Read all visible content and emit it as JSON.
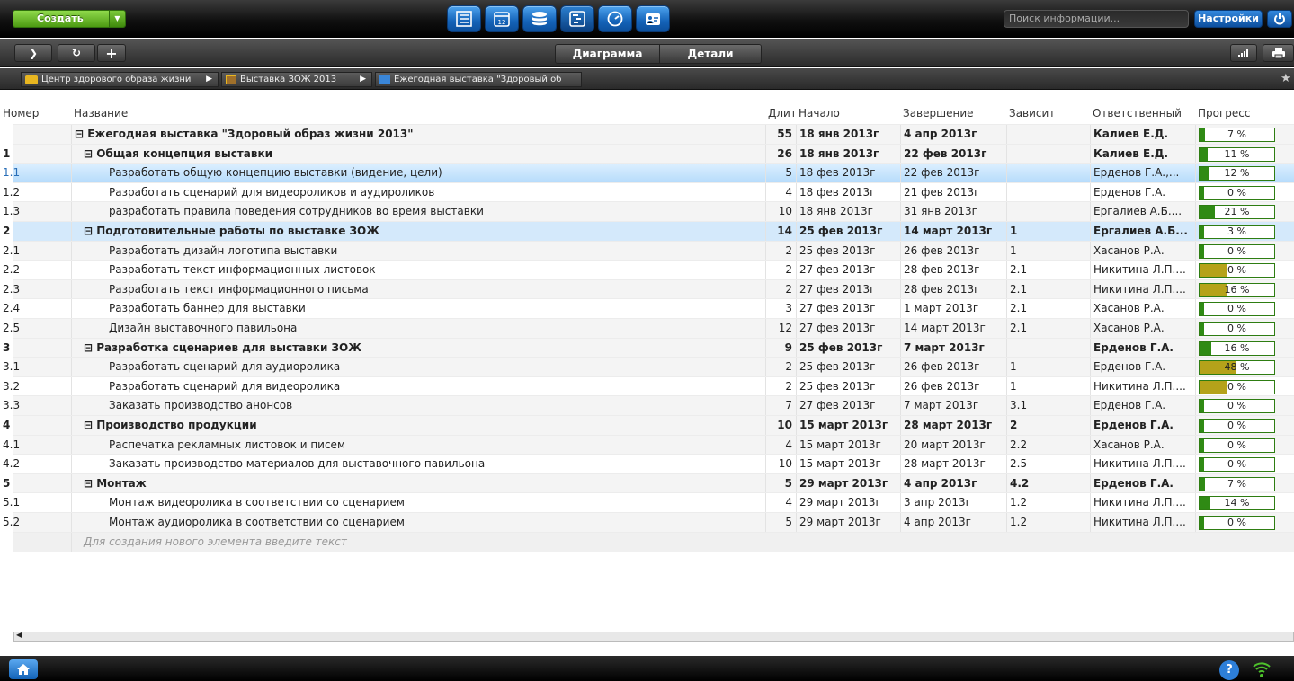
{
  "topbar": {
    "create_label": "Создать",
    "search_placeholder": "Поиск информации...",
    "settings_label": "Настройки",
    "views": [
      "tasks-icon",
      "calendar-icon",
      "database-icon",
      "gantt-icon",
      "dashboard-icon",
      "contacts-icon"
    ]
  },
  "toolbar": {
    "tab_diagram": "Диаграмма",
    "tab_details": "Детали"
  },
  "breadcrumbs": [
    {
      "label": "Центр здорового образа жизни",
      "icon": "folder-icon"
    },
    {
      "label": "Выставка ЗОЖ 2013",
      "icon": "project-icon"
    },
    {
      "label": "Ежегодная выставка \"Здоровый об",
      "icon": "gantt-icon"
    }
  ],
  "columns": {
    "num": "Номер",
    "name": "Название",
    "dur": "Длител",
    "start": "Начало",
    "end": "Завершение",
    "dep": "Зависит",
    "owner": "Ответственный",
    "progress": "Прогресс"
  },
  "rows": [
    {
      "num": "",
      "name": "⊟ Ежегодная выставка \"Здоровый образ жизни 2013\"",
      "dur": "55",
      "start": "18 янв 2013г",
      "end": "4 апр 2013г",
      "dep": "",
      "owner": "Калиев Е.Д.",
      "progress": "7 %",
      "pct": 7,
      "level": 0,
      "summary": true
    },
    {
      "num": "1",
      "name": "⊟ Общая концепция выставки",
      "dur": "26",
      "start": "18 янв 2013г",
      "end": "22 фев 2013г",
      "dep": "",
      "owner": "Калиев Е.Д.",
      "progress": "11 %",
      "pct": 11,
      "level": 1,
      "summary": true
    },
    {
      "num": "1.1",
      "name": "Разработать общую концепцию выставки (видение, цели)",
      "dur": "5",
      "start": "18 фев 2013г",
      "end": "22 фев 2013г",
      "dep": "",
      "owner": "Ерденов Г.А.,...",
      "progress": "12 %",
      "pct": 12,
      "level": 2,
      "selected": true
    },
    {
      "num": "1.2",
      "name": "Разработать сценарий для видеороликов и аудироликов",
      "dur": "4",
      "start": "18 фев 2013г",
      "end": "21 фев 2013г",
      "dep": "",
      "owner": "Ерденов Г.А.",
      "progress": "0 %",
      "pct": 0,
      "level": 2
    },
    {
      "num": "1.3",
      "name": "разработать правила поведения сотрудников во время выставки",
      "dur": "10",
      "start": "18 янв 2013г",
      "end": "31 янв 2013г",
      "dep": "",
      "owner": "Ергалиев А.Б....",
      "progress": "21 %",
      "pct": 21,
      "level": 2
    },
    {
      "num": "2",
      "name": "⊟ Подготовительные работы по выставке ЗОЖ",
      "dur": "14",
      "start": "25 фев 2013г",
      "end": "14 март 2013г",
      "dep": "1",
      "owner": "Ергалиев А.Б...",
      "progress": "3 %",
      "pct": 3,
      "level": 1,
      "summary": true,
      "hl": true
    },
    {
      "num": "2.1",
      "name": "Разработать дизайн логотипа выставки",
      "dur": "2",
      "start": "25 фев 2013г",
      "end": "26 фев 2013г",
      "dep": "1",
      "owner": "Хасанов Р.А.",
      "progress": "0 %",
      "pct": 0,
      "level": 2
    },
    {
      "num": "2.2",
      "name": "Разработать текст информационных листовок",
      "dur": "2",
      "start": "27 фев 2013г",
      "end": "28 фев 2013г",
      "dep": "2.1",
      "owner": "Никитина Л.П....",
      "progress": "0 %",
      "pct": 0,
      "level": 2,
      "warn": true
    },
    {
      "num": "2.3",
      "name": "Разработать текст информационного письма",
      "dur": "2",
      "start": "27 фев 2013г",
      "end": "28 фев 2013г",
      "dep": "2.1",
      "owner": "Никитина Л.П....",
      "progress": "16 %",
      "pct": 16,
      "level": 2,
      "warn": true
    },
    {
      "num": "2.4",
      "name": "Разработать баннер для выставки",
      "dur": "3",
      "start": "27 фев 2013г",
      "end": "1 март 2013г",
      "dep": "2.1",
      "owner": "Хасанов Р.А.",
      "progress": "0 %",
      "pct": 0,
      "level": 2
    },
    {
      "num": "2.5",
      "name": "Дизайн выставочного павильона",
      "dur": "12",
      "start": "27 фев 2013г",
      "end": "14 март 2013г",
      "dep": "2.1",
      "owner": "Хасанов Р.А.",
      "progress": "0 %",
      "pct": 0,
      "level": 2
    },
    {
      "num": "3",
      "name": "⊟ Разработка сценариев для выставки ЗОЖ",
      "dur": "9",
      "start": "25 фев 2013г",
      "end": "7 март 2013г",
      "dep": "",
      "owner": "Ерденов Г.А.",
      "progress": "16 %",
      "pct": 16,
      "level": 1,
      "summary": true
    },
    {
      "num": "3.1",
      "name": "Разработать сценарий для аудиоролика",
      "dur": "2",
      "start": "25 фев 2013г",
      "end": "26 фев 2013г",
      "dep": "1",
      "owner": "Ерденов Г.А.",
      "progress": "48 %",
      "pct": 48,
      "level": 2,
      "warn": true
    },
    {
      "num": "3.2",
      "name": "Разработать сценарий для видеоролика",
      "dur": "2",
      "start": "25 фев 2013г",
      "end": "26 фев 2013г",
      "dep": "1",
      "owner": "Никитина Л.П....",
      "progress": "0 %",
      "pct": 0,
      "level": 2,
      "warn": true
    },
    {
      "num": "3.3",
      "name": "Заказать производство анонсов",
      "dur": "7",
      "start": "27 фев 2013г",
      "end": "7 март 2013г",
      "dep": "3.1",
      "owner": "Ерденов Г.А.",
      "progress": "0 %",
      "pct": 0,
      "level": 2
    },
    {
      "num": "4",
      "name": "⊟ Производство продукции",
      "dur": "10",
      "start": "15 март 2013г",
      "end": "28 март 2013г",
      "dep": "2",
      "owner": "Ерденов Г.А.",
      "progress": "0 %",
      "pct": 0,
      "level": 1,
      "summary": true
    },
    {
      "num": "4.1",
      "name": "Распечатка рекламных листовок и писем",
      "dur": "4",
      "start": "15 март 2013г",
      "end": "20 март 2013г",
      "dep": "2.2",
      "owner": "Хасанов Р.А.",
      "progress": "0 %",
      "pct": 0,
      "level": 2
    },
    {
      "num": "4.2",
      "name": "Заказать производство материалов для выставочного павильона",
      "dur": "10",
      "start": "15 март 2013г",
      "end": "28 март 2013г",
      "dep": "2.5",
      "owner": "Никитина Л.П....",
      "progress": "0 %",
      "pct": 0,
      "level": 2
    },
    {
      "num": "5",
      "name": "⊟ Монтаж",
      "dur": "5",
      "start": "29 март 2013г",
      "end": "4 апр 2013г",
      "dep": "4.2",
      "owner": "Ерденов Г.А.",
      "progress": "7 %",
      "pct": 7,
      "level": 1,
      "summary": true
    },
    {
      "num": "5.1",
      "name": "Монтаж видеоролика в соответствии со сценарием",
      "dur": "4",
      "start": "29 март 2013г",
      "end": "3 апр 2013г",
      "dep": "1.2",
      "owner": "Никитина Л.П....",
      "progress": "14 %",
      "pct": 14,
      "level": 2
    },
    {
      "num": "5.2",
      "name": "Монтаж аудиоролика в соответствии со сценарием",
      "dur": "5",
      "start": "29 март 2013г",
      "end": "4 апр 2013г",
      "dep": "1.2",
      "owner": "Никитина Л.П....",
      "progress": "0 %",
      "pct": 0,
      "level": 2
    }
  ],
  "new_item_placeholder": "Для создания нового элемента введите текст",
  "colors": {
    "progress_fill": "#2f8a14",
    "progress_warn": "#b5a21a",
    "selected_row": "#b7dcfb",
    "accent_blue": "#1463b8"
  }
}
